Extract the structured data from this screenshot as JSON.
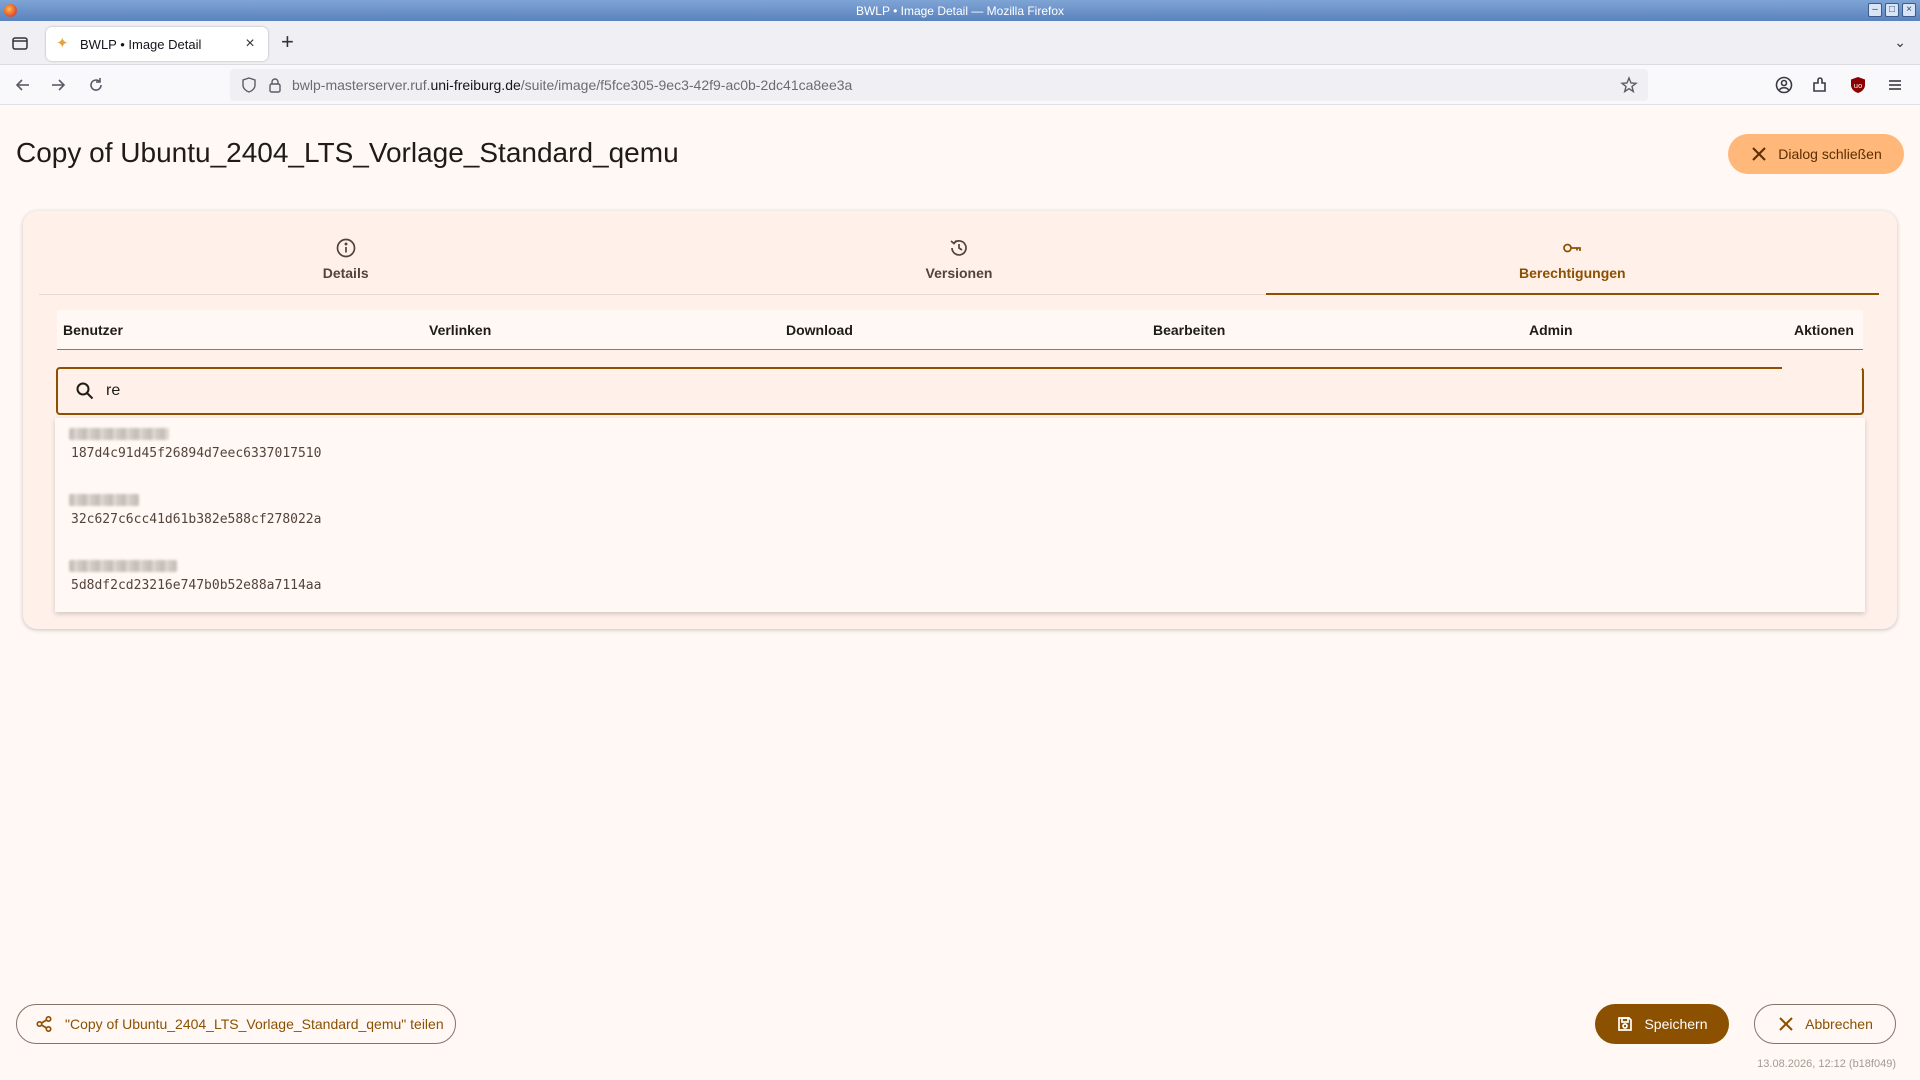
{
  "window": {
    "title": "BWLP • Image Detail — Mozilla Firefox"
  },
  "browser": {
    "tab_title": "BWLP • Image Detail",
    "url_prefix": "bwlp-masterserver.ruf.",
    "url_host": "uni-freiburg.de",
    "url_path": "/suite/image/f5fce305-9ec3-42f9-ac0b-2dc41ca8ee3a"
  },
  "page": {
    "title": "Copy of Ubuntu_2404_LTS_Vorlage_Standard_qemu",
    "close_dialog_label": "Dialog schließen"
  },
  "tabs": [
    {
      "label": "Details",
      "icon": "info-icon"
    },
    {
      "label": "Versionen",
      "icon": "history-icon"
    },
    {
      "label": "Berechtigungen",
      "icon": "key-icon",
      "active": true
    }
  ],
  "permissions": {
    "columns": [
      "Benutzer",
      "Verlinken",
      "Download",
      "Bearbeiten",
      "Admin",
      "Aktionen"
    ],
    "search_value": "re",
    "results": [
      {
        "id": "187d4c91d45f26894d7eec6337017510"
      },
      {
        "id": "32c627c6cc41d61b382e588cf278022a"
      },
      {
        "id": "5d8df2cd23216e747b0b52e88a7114aa"
      }
    ]
  },
  "footer": {
    "share_label": "\"Copy of Ubuntu_2404_LTS_Vorlage_Standard_qemu\" teilen",
    "save_label": "Speichern",
    "cancel_label": "Abbrechen",
    "build_info": "13.08.2026, 12:12 (b18f049)"
  },
  "colors": {
    "accent": "#8b5000",
    "accent_light": "#ffb77a",
    "background": "#fff8f4",
    "card": "#fff1ea"
  }
}
